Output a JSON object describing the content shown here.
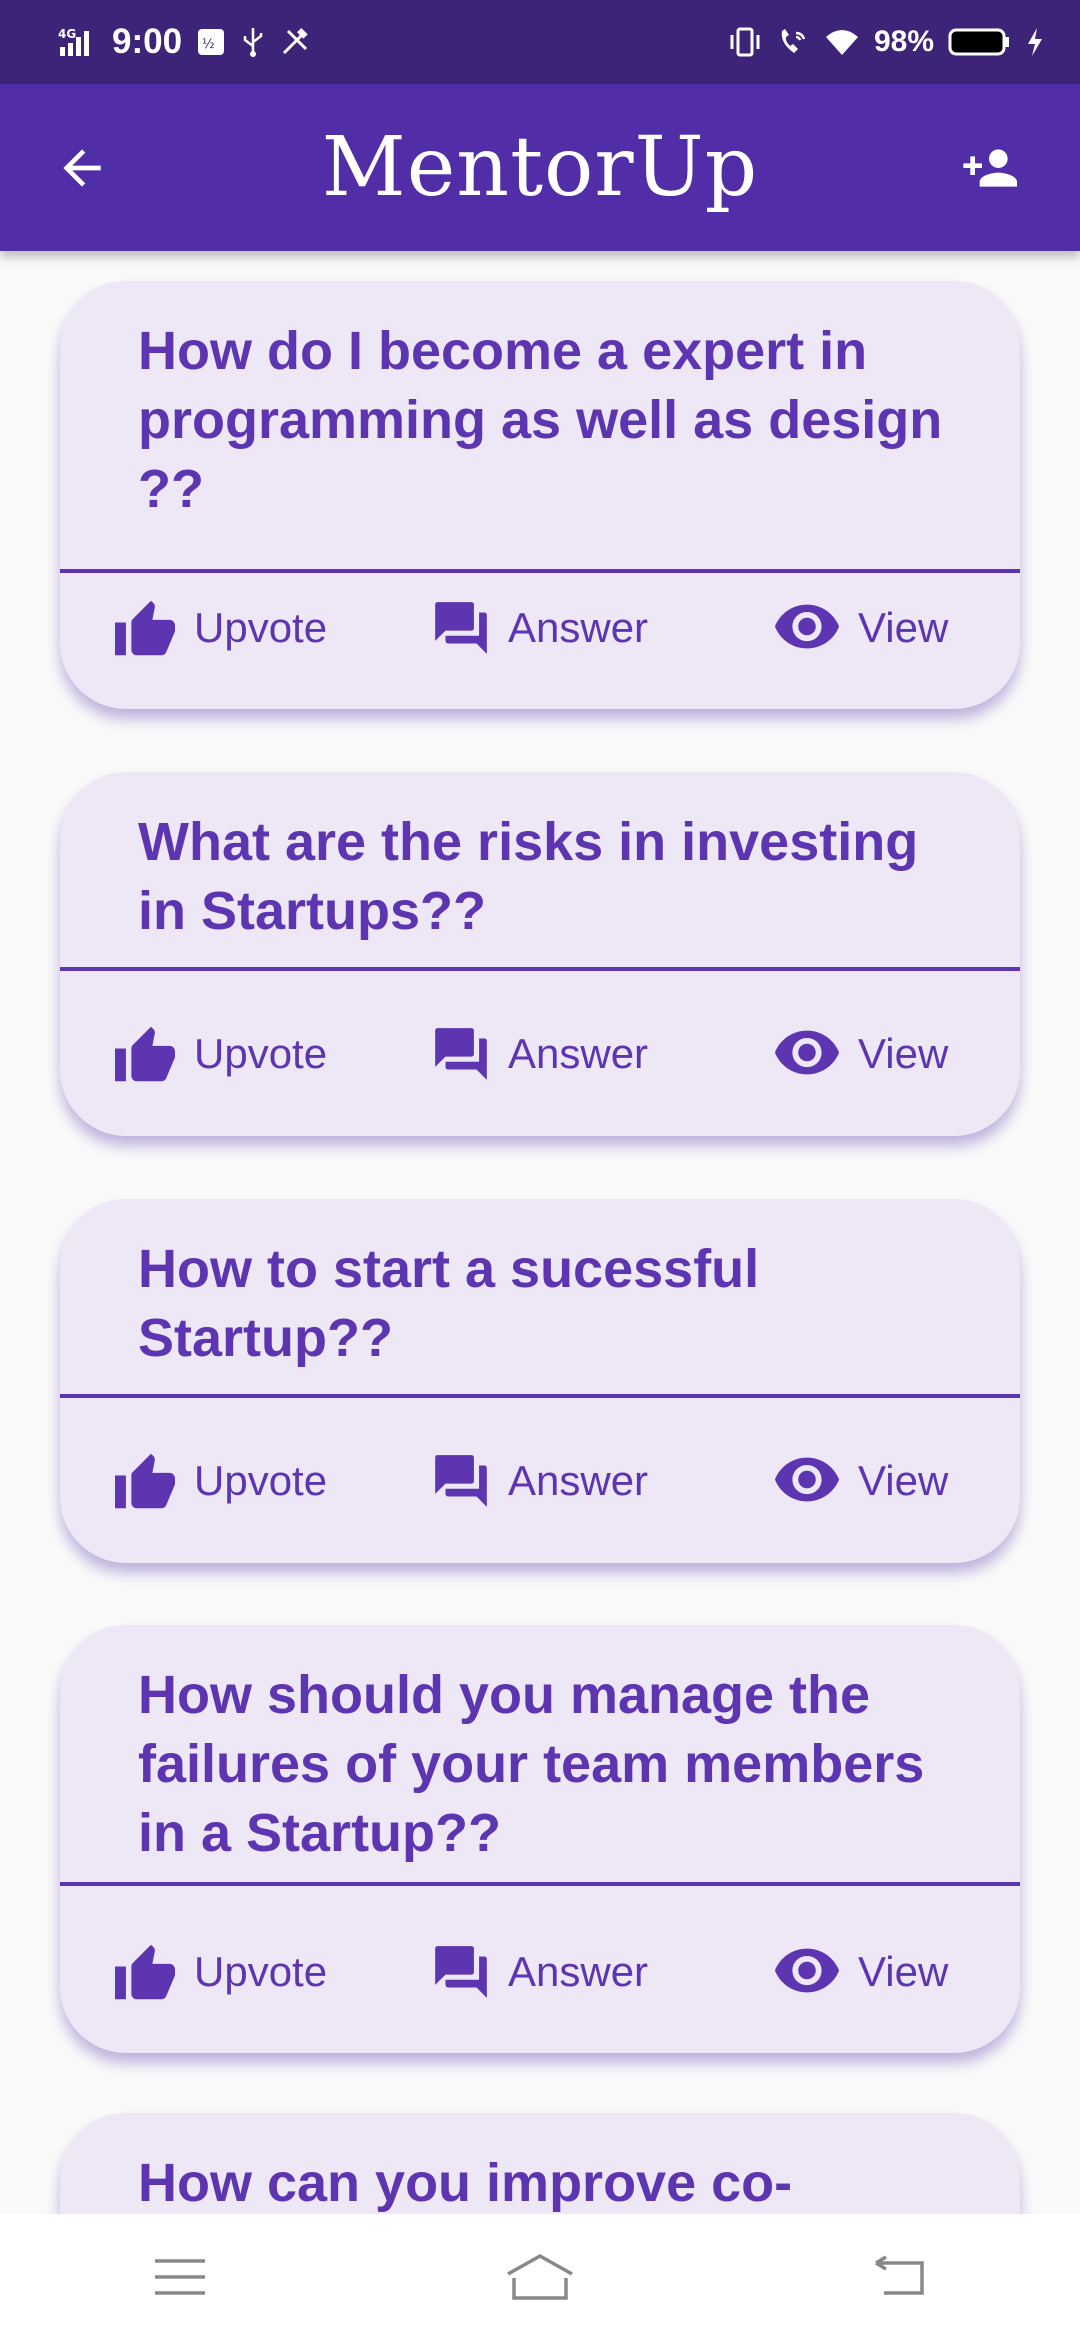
{
  "status_bar": {
    "network": "4G",
    "time": "9:00",
    "battery": "98%"
  },
  "app_bar": {
    "title": "MentorUp",
    "back_icon": "arrow-back-icon",
    "add_icon": "person-add-icon"
  },
  "questions": [
    {
      "title": "How do I become a expert in programming as well as design ??"
    },
    {
      "title": "What are the risks in investing in Startups??"
    },
    {
      "title": "How to start a sucessful Startup??"
    },
    {
      "title": "How should you manage the failures of your team members in a Startup??"
    },
    {
      "title": "How can you improve co-"
    }
  ],
  "actions": {
    "upvote": "Upvote",
    "answer": "Answer",
    "view": "View"
  },
  "colors": {
    "status_bar": "#3e2479",
    "app_bar": "#512da8",
    "card_bg": "#ede7f6",
    "accent": "#5e35b1"
  }
}
